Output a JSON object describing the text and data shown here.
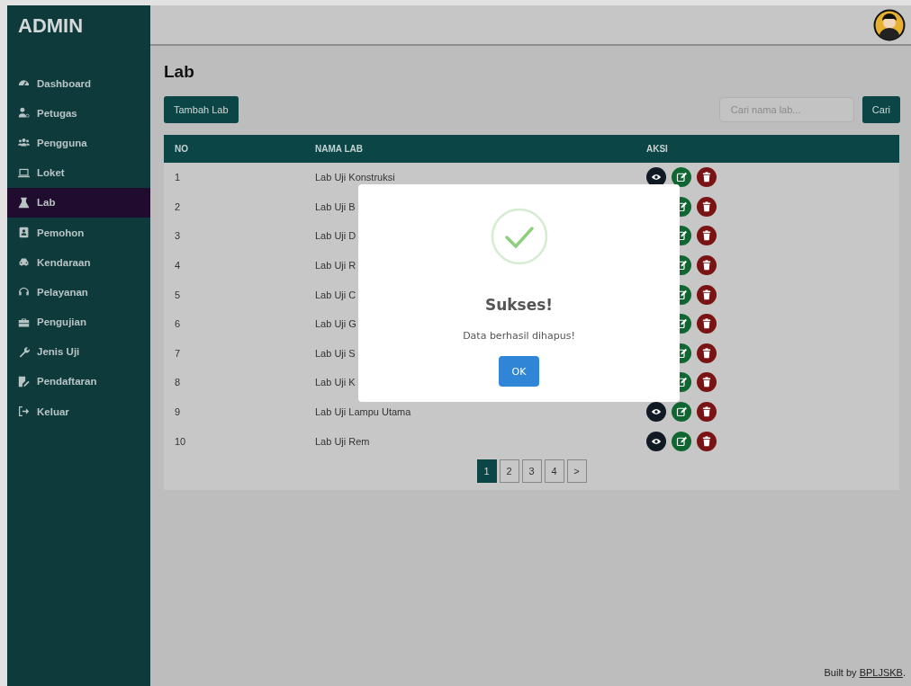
{
  "sidebar": {
    "title": "ADMIN",
    "items": [
      {
        "label": "Dashboard",
        "selected": false
      },
      {
        "label": "Petugas",
        "selected": false
      },
      {
        "label": "Pengguna",
        "selected": false
      },
      {
        "label": "Loket",
        "selected": false
      },
      {
        "label": "Lab",
        "selected": true
      },
      {
        "label": "Pemohon",
        "selected": false
      },
      {
        "label": "Kendaraan",
        "selected": false
      },
      {
        "label": "Pelayanan",
        "selected": false
      },
      {
        "label": "Pengujian",
        "selected": false
      },
      {
        "label": "Jenis Uji",
        "selected": false
      },
      {
        "label": "Pendaftaran",
        "selected": false
      },
      {
        "label": "Keluar",
        "selected": false
      }
    ]
  },
  "page": {
    "title": "Lab",
    "add_button": "Tambah Lab",
    "search": {
      "placeholder": "Cari nama lab...",
      "button": "Cari"
    }
  },
  "table": {
    "columns": [
      "NO",
      "NAMA LAB",
      "AKSI"
    ],
    "rows": [
      {
        "no": "1",
        "name": "Lab Uji Konstruksi"
      },
      {
        "no": "2",
        "name": "Lab Uji B"
      },
      {
        "no": "3",
        "name": "Lab Uji D"
      },
      {
        "no": "4",
        "name": "Lab Uji R"
      },
      {
        "no": "5",
        "name": "Lab Uji C"
      },
      {
        "no": "6",
        "name": "Lab Uji G"
      },
      {
        "no": "7",
        "name": "Lab Uji S"
      },
      {
        "no": "8",
        "name": "Lab Uji K"
      },
      {
        "no": "9",
        "name": "Lab Uji Lampu Utama"
      },
      {
        "no": "10",
        "name": "Lab Uji Rem"
      }
    ]
  },
  "pagination": {
    "pages": [
      {
        "label": "1",
        "selected": true
      },
      {
        "label": "2",
        "selected": false
      },
      {
        "label": "3",
        "selected": false
      },
      {
        "label": "4",
        "selected": false
      }
    ],
    "next": ">"
  },
  "dialog": {
    "title": "Sukses!",
    "message": "Data berhasil dihapus!",
    "button": "OK"
  },
  "footer": {
    "text": "Built by",
    "link": "BPLJSKB",
    "suffix": "."
  }
}
